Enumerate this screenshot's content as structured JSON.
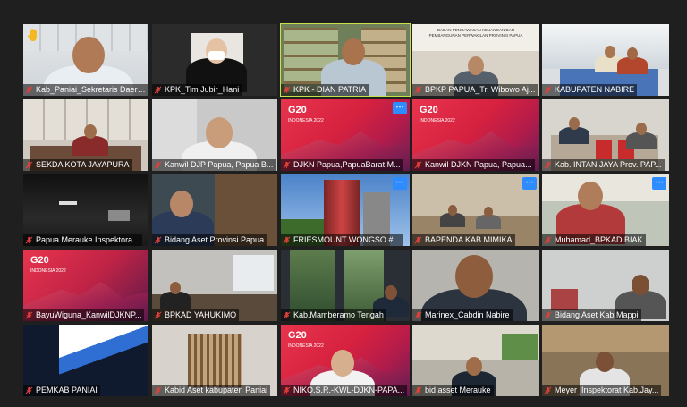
{
  "colors": {
    "active_border": "#c8e34a",
    "more_button": "#2d8cff",
    "mic_muted": "#e0413a"
  },
  "tiles": [
    {
      "name": "Kab_Paniai_Sekretaris Daerah_...",
      "hand": true
    },
    {
      "name": "KPK_Tim Jubir_Hani"
    },
    {
      "name": "KPK - DIAN PATRIA",
      "active": true
    },
    {
      "name": "BPKP PAPUA_Tri Wibowo Aj..."
    },
    {
      "name": "KABUPATEN NABIRE"
    },
    {
      "name": "SEKDA KOTA JAYAPURA"
    },
    {
      "name": "Kanwil DJP Papua, Papua B..."
    },
    {
      "name": "DJKN Papua,PapuaBarat,M...",
      "more": true
    },
    {
      "name": "Kanwil DJKN Papua, Papua..."
    },
    {
      "name": "Kab. INTAN JAYA Prov. PAP..."
    },
    {
      "name": "Papua Merauke Inspektora..."
    },
    {
      "name": "Bidang Aset Provinsi Papua"
    },
    {
      "name": "FRIESMOUNT WONGSO #...",
      "more": true
    },
    {
      "name": "BAPENDA KAB MIMIKA",
      "more": true
    },
    {
      "name": "Muhamad_BPKAD BIAK",
      "more": true
    },
    {
      "name": "BayuWiguna_KanwilDJKNP..."
    },
    {
      "name": "BPKAD YAHUKIMO"
    },
    {
      "name": "Kab.Mamberamo Tengah"
    },
    {
      "name": "Marinex_Cabdin Nabire"
    },
    {
      "name": "Bidang Aset Kab.Mappi"
    },
    {
      "name": "PEMKAB PANIAI"
    },
    {
      "name": "Kabid Aset kabupaten Paniai"
    },
    {
      "name": "NIKO.S.R.-KWL-DJKN-PAPA..."
    },
    {
      "name": "bid asset Merauke"
    },
    {
      "name": "Meyer_Inspektorat Kab.Jay..."
    }
  ],
  "g20": {
    "title": "G20",
    "subtitle": "INDONESIA 2022"
  },
  "banner_text": "BADAN PENGAWASAN KEUANGAN DAN PEMBANGUNAN PERWAKILAN PROVINSI PAPUA"
}
